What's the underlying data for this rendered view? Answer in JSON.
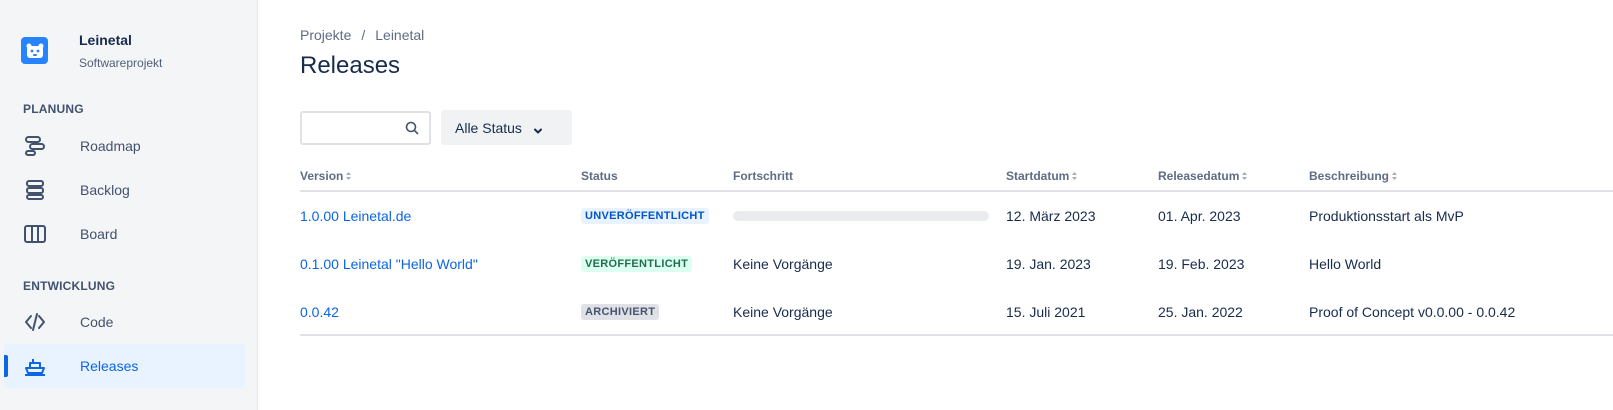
{
  "sidebar": {
    "project_name": "Leinetal",
    "project_type": "Softwareprojekt",
    "sections": [
      {
        "label": "PLANUNG"
      },
      {
        "label": "ENTWICKLUNG"
      }
    ],
    "items": [
      {
        "label": "Roadmap",
        "icon": "roadmap-icon"
      },
      {
        "label": "Backlog",
        "icon": "backlog-icon"
      },
      {
        "label": "Board",
        "icon": "board-icon"
      },
      {
        "label": "Code",
        "icon": "code-icon"
      },
      {
        "label": "Releases",
        "icon": "ship-icon",
        "active": true
      }
    ]
  },
  "breadcrumb": {
    "root": "Projekte",
    "separator": "/",
    "current": "Leinetal"
  },
  "page_title": "Releases",
  "filters": {
    "search_placeholder": "",
    "search_value": "",
    "status_label": "Alle Status"
  },
  "table": {
    "columns": [
      "Version",
      "Status",
      "Fortschritt",
      "Startdatum",
      "Releasedatum",
      "Beschreibung"
    ],
    "rows": [
      {
        "version": "1.0.00 Leinetal.de",
        "status": "UNVERÖFFENTLICHT",
        "progress_text": "",
        "progress": 0,
        "start": "12. März 2023",
        "release": "01. Apr. 2023",
        "description": "Produktionsstart als MvP"
      },
      {
        "version": "0.1.00 Leinetal \"Hello World\"",
        "status": "VERÖFFENTLICHT",
        "progress_text": "Keine Vorgänge",
        "start": "19. Jan. 2023",
        "release": "19. Feb. 2023",
        "description": "Hello World"
      },
      {
        "version": "0.0.42",
        "status": "ARCHIVIERT",
        "progress_text": "Keine Vorgänge",
        "start": "15. Juli 2021",
        "release": "25. Jan. 2022",
        "description": "Proof of Concept v0.0.00 - 0.0.42"
      }
    ]
  },
  "colors": {
    "accent": "#0c66e4",
    "sidebar_bg": "#f4f5f7",
    "avatar": "#2684ff"
  }
}
